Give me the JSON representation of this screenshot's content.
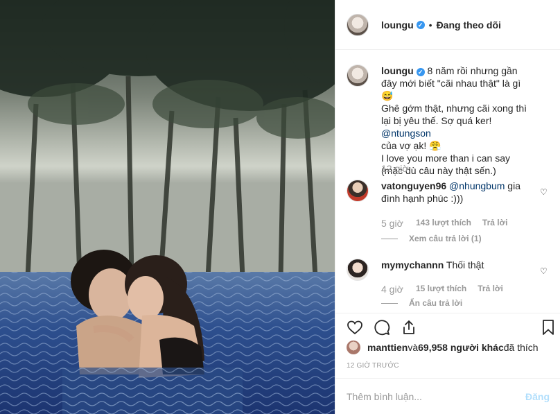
{
  "header": {
    "username": "loungu",
    "verified_mark": "✓",
    "separator": "•",
    "follow_status": "Đang theo dõi"
  },
  "caption": {
    "username": "loungu",
    "text_part1": " 8 năm rồi nhưng gần đây mới biết \"cãi nhau thật\" là gì 😅",
    "text_part2": "Ghê gớm thật, nhưng cãi xong thì lại bị yêu thế. Sợ quá ker! ",
    "mention": "@ntungson",
    "text_part3": "của vợ ạk! 😤",
    "text_part4": "I love you more than i can say (mặc dù câu này thật sến.)",
    "time": "12 giờ"
  },
  "comments": [
    {
      "username": "vatonguyen96",
      "mention": "@nhungbum",
      "text": " gia đình hạnh phúc :)))",
      "time": "5 giờ",
      "likes": "143 lượt thích",
      "reply_label": "Trả lời",
      "view_replies": "Xem câu trả lời (1)"
    },
    {
      "username": "mymychannn",
      "text": " Thối thật",
      "time": "4 giờ",
      "likes": "15 lượt thích",
      "reply_label": "Trả lời",
      "view_replies": "Ẩn câu trả lời"
    }
  ],
  "likes_summary": {
    "user": "manttien",
    "middle": " và ",
    "count": "69,958 người khác",
    "end": " đã thích"
  },
  "timestamp": "12 GIỜ TRƯỚC",
  "add_comment": {
    "placeholder": "Thêm bình luận...",
    "post_label": "Đăng"
  },
  "icons": {
    "like": "heart-icon",
    "comment": "comment-icon",
    "share": "share-icon",
    "save": "bookmark-icon"
  },
  "colors": {
    "verified": "#3897f0",
    "link": "#003569",
    "muted": "#999999",
    "post_button": "#b2dffc"
  }
}
